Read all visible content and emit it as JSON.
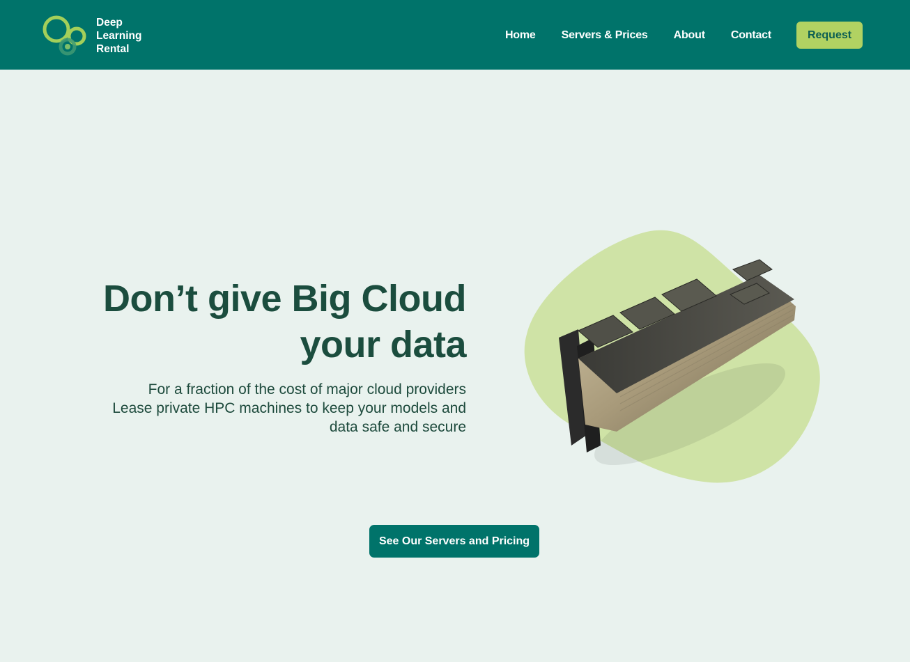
{
  "header": {
    "logo": {
      "icon": "circles-logo-icon",
      "text_lines": [
        "Deep",
        "Learning",
        "Rental"
      ],
      "colors": {
        "outer_ring": "#a3cf5a",
        "inner_ring": "#7fbf6a",
        "small_circle": "#3f9a73"
      }
    },
    "nav": [
      {
        "label": "Home"
      },
      {
        "label": "Servers & Prices"
      },
      {
        "label": "About"
      },
      {
        "label": "Contact"
      }
    ],
    "request_label": "Request"
  },
  "hero": {
    "title_lines": [
      "Don’t give Big Cloud",
      "your data"
    ],
    "subtitle_lines": [
      "For a fraction of the cost of major cloud providers",
      "Lease private HPC machines to keep your models and",
      "data safe and secure"
    ],
    "image": {
      "icon": "gpu-card-icon",
      "blob_color": "#cfe3a6"
    }
  },
  "cta": {
    "label": "See Our Servers and Pricing"
  },
  "colors": {
    "header_bg": "#00736a",
    "page_bg": "#e9f2ee",
    "accent": "#b1d262",
    "title": "#1b4d3e",
    "button_bg": "#00736a"
  }
}
